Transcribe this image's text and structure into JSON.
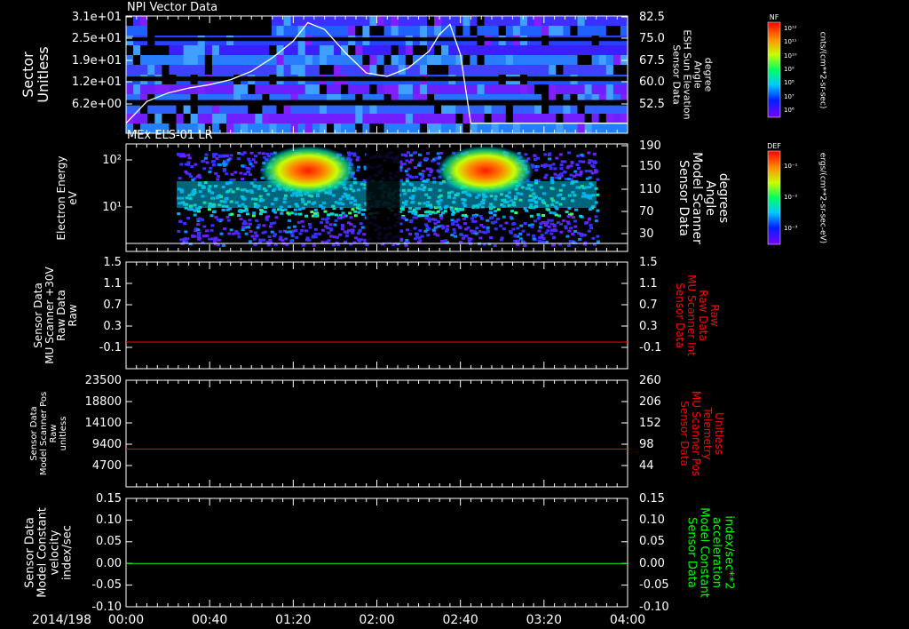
{
  "chart_data": [
    {
      "type": "heatmap",
      "title": "NPI Vector Data",
      "ylabel_left": [
        "Sector",
        "Unitless"
      ],
      "yticks_left": [
        "3.1e+01",
        "2.5e+01",
        "1.9e+01",
        "1.2e+01",
        "6.2e+00"
      ],
      "ylabel_right": [
        "Sensor Data",
        "ESH Sun Elevation",
        "Angle",
        "degree"
      ],
      "yticks_right": [
        "82.5",
        "75.0",
        "67.5",
        "60.0",
        "52.5"
      ],
      "y2lim": [
        47.5,
        82.5
      ],
      "overlay_line": {
        "name": "ESH Sun Elevation Angle",
        "color": "#ffffff",
        "x": [
          "00:00",
          "00:10",
          "00:20",
          "00:30",
          "00:40",
          "00:50",
          "01:00",
          "01:10",
          "01:20",
          "01:27",
          "01:35",
          "01:45",
          "01:55",
          "02:05",
          "02:15",
          "02:25",
          "02:30",
          "02:35",
          "02:40",
          "02:45",
          "03:00",
          "03:20",
          "03:40",
          "04:00"
        ],
        "y": [
          50.5,
          57.0,
          59.5,
          61.0,
          62.0,
          63.5,
          66.0,
          70.0,
          75.0,
          80.5,
          78.5,
          71.5,
          65.5,
          64.5,
          67.0,
          72.0,
          77.0,
          80.0,
          71.0,
          50.5,
          50.5,
          50.5,
          50.5,
          50.5
        ]
      },
      "colorbar": {
        "title": "NF",
        "units": "cnts/(cm**2-sr-sec)",
        "ticks": [
          "10¹²",
          "10¹¹",
          "10¹⁰",
          "10⁹",
          "10⁸",
          "10⁷",
          "10⁶"
        ]
      }
    },
    {
      "type": "heatmap",
      "title": "MEx ELS-01 LR",
      "ylabel_left": [
        "Electron Energy",
        "eV"
      ],
      "yticks_left": [
        "10²",
        "10¹"
      ],
      "ylabel_right": [
        "Sensor Data",
        "Model Scanner",
        "Angle",
        "degrees"
      ],
      "yticks_right": [
        "190",
        "150",
        "110",
        "70",
        "30"
      ],
      "y2lim": [
        0,
        190
      ],
      "colorbar": {
        "title": "DEF",
        "units": "ergs/(cm**2-sr-sec-eV)",
        "ticks": [
          "10⁻¹",
          "10⁻²",
          "10⁻³"
        ]
      }
    },
    {
      "type": "line",
      "ylabel_left": [
        "Sensor Data",
        "MU Scanner +30V",
        "Raw Data",
        "Raw"
      ],
      "yticks_left": [
        "1.5",
        "1.1",
        "0.7",
        "0.3",
        "-0.1"
      ],
      "ylim": [
        -0.5,
        1.5
      ],
      "ylabel_right": [
        "Sensor Data",
        "MU Scanner Int",
        "Raw Data",
        "Raw"
      ],
      "yticks_right": [
        "1.5",
        "1.1",
        "0.7",
        "0.3",
        "-0.1"
      ],
      "series": [
        {
          "name": "MU Scanner Int Raw Data",
          "color": "#ff0000",
          "y": 0.0
        }
      ]
    },
    {
      "type": "line",
      "ylabel_left": [
        "Sensor Data",
        "Model Scanner Pos",
        "Raw",
        "unitless"
      ],
      "yticks_left": [
        "23500",
        "18800",
        "14100",
        "9400",
        "4700"
      ],
      "ylim": [
        0,
        23500
      ],
      "ylabel_right": [
        "Sensor Data",
        "MU Scanner Pos",
        "Telemetry",
        "Unitless"
      ],
      "yticks_right": [
        "260",
        "206",
        "152",
        "98",
        "44"
      ],
      "y2lim": [
        -10,
        260
      ],
      "series": [
        {
          "name": "MU Scanner Pos Telemetry",
          "color": "#ff0000",
          "y2": 86
        }
      ]
    },
    {
      "type": "line",
      "ylabel_left": [
        "Sensor Data",
        "Model Constant",
        "velocity",
        "index/sec"
      ],
      "yticks_left": [
        "0.15",
        "0.10",
        "0.05",
        "0.00",
        "-0.05",
        "-0.10"
      ],
      "ylim": [
        -0.1,
        0.15
      ],
      "ylabel_right": [
        "Sensor Data",
        "Model Constant",
        "acceleration",
        "index/sec**2"
      ],
      "yticks_right": [
        "0.15",
        "0.10",
        "0.05",
        "0.00",
        "-0.05",
        "-0.10"
      ],
      "series": [
        {
          "name": "Model Constant acceleration",
          "color": "#00ff00",
          "y": 0.0
        }
      ]
    }
  ],
  "xaxis": {
    "date": "2014/198",
    "ticks": [
      "00:00",
      "00:40",
      "01:20",
      "02:00",
      "02:40",
      "03:20",
      "04:00"
    ]
  },
  "colors": {
    "ytext_red": "#ff0000",
    "ytext_green": "#00ff00",
    "text": "#ffffff"
  }
}
